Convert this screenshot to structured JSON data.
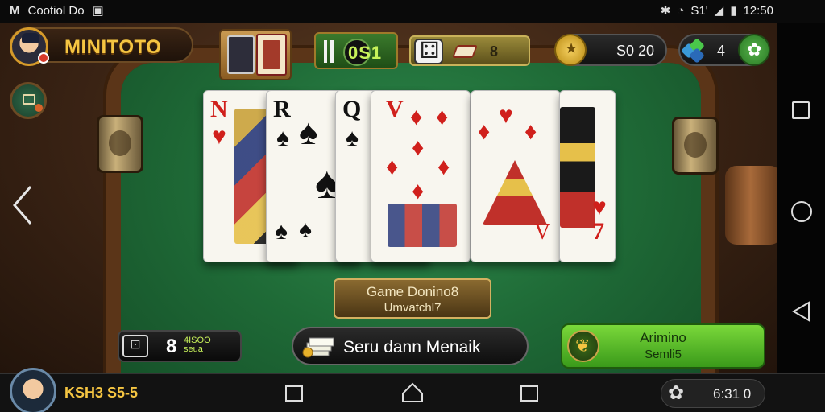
{
  "status_bar": {
    "carrier": "Cootiol Do",
    "signal_text": "S1'",
    "time": "12:50"
  },
  "header": {
    "brand": "MINITOTO",
    "score_display": "0S1",
    "dice_count": "8",
    "coins": "S0 20",
    "gems": "4"
  },
  "table": {
    "cards": [
      {
        "rank": "N",
        "suit": "♥",
        "color": "red"
      },
      {
        "rank": "R",
        "suit": "♠",
        "color": "black"
      },
      {
        "rank": "Q",
        "suit": "♠",
        "color": "black"
      },
      {
        "rank": "V",
        "suit": "♦",
        "color": "red"
      },
      {
        "rank": "",
        "suit": "♦",
        "color": "red"
      },
      {
        "rank": "7",
        "suit": "♥",
        "color": "red"
      }
    ]
  },
  "controls": {
    "game_mode_line1": "Game Donino8",
    "game_mode_line2": "Umvatchl7",
    "bet_value": "8",
    "bet_sub": "4ISOO seua",
    "play_label": "Seru dann Menaik",
    "green_line1": "Arimino",
    "green_line2": "Semli5"
  },
  "bottom_bar": {
    "player_name": "KSH3 S5-5",
    "balance": "6:31 0"
  },
  "colors": {
    "felt": "#1f6b37",
    "gold": "#f5c542",
    "green_button": "#5ab82a",
    "card_red": "#d0201c"
  }
}
